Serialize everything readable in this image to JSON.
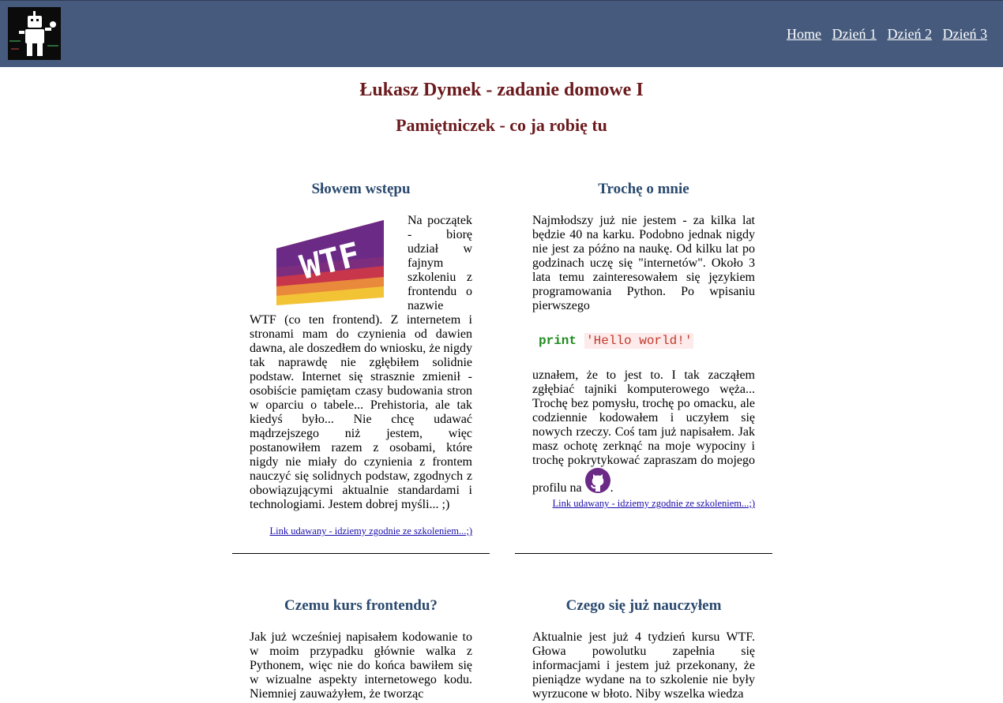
{
  "nav": {
    "home": "Home",
    "day1": "Dzień 1",
    "day2": "Dzień 2",
    "day3": "Dzień 3"
  },
  "header": {
    "title": "Łukasz Dymek - zadanie domowe I",
    "subtitle": "Pamiętniczek - co ja robię tu"
  },
  "sections": {
    "intro": {
      "heading": "Słowem wstępu",
      "logo_text": "WTF",
      "text": "Na początek - biorę udział w fajnym szkoleniu z frontendu o nazwie WTF (co ten frontend). Z internetem i stronami mam do czynienia od dawien dawna, ale doszedłem do wniosku, że nigdy tak naprawdę nie zgłębiłem solidnie podstaw. Internet się strasznie zmienił - osobiście pamiętam czasy budowania stron w oparciu o tabele... Prehistoria, ale tak kiedyś było... Nie chcę udawać mądrzejszego niż jestem, więc postanowiłem razem z osobami, które nigdy nie miały do czynienia z frontem nauczyć się solidnych podstaw, zgodnych z obowiązującymi aktualnie standardami i technologiami. Jestem dobrej myśli... ;)",
      "link": "Link udawany - idziemy zgodnie ze szkoleniem...;)"
    },
    "about": {
      "heading": "Trochę o mnie",
      "text1": "Najmłodszy już nie jestem - za kilka lat będzie 40 na karku. Podobno jednak nigdy nie jest za późno na naukę. Od kilku lat po godzinach uczę się \"internetów\". Około 3 lata temu zainteresowałem się językiem programowania Python. Po wpisaniu pierwszego",
      "code_keyword": "print",
      "code_string": "'Hello world!'",
      "text2": "uznałem, że to jest to. I tak zacząłem zgłębiać tajniki komputerowego węża... Trochę bez pomysłu, trochę po omacku, ale codziennie kodowałem i uczyłem się nowych rzeczy. Coś tam już napisałem. Jak masz ochotę zerknąć na moje wypociny i trochę pokrytykować zapraszam do mojego profilu na",
      "text2_end": ".",
      "link": "Link udawany - idziemy zgodnie ze szkoleniem...;)"
    },
    "why": {
      "heading": "Czemu kurs frontendu?",
      "text": "Jak już wcześniej napisałem kodowanie to w moim przypadku głównie walka z Pythonem, więc nie do końca bawiłem się w wizualne aspekty internetowego kodu. Niemniej zauważyłem, że tworząc"
    },
    "learned": {
      "heading": "Czego się już nauczyłem",
      "text": "Aktualnie jest już 4 tydzień kursu WTF. Głowa powolutku zapełnia się informacjami i jestem już przekonany, że pieniądze wydane na to szkolenie nie były wyrzucone w błoto. Niby wszelka wiedza"
    }
  }
}
